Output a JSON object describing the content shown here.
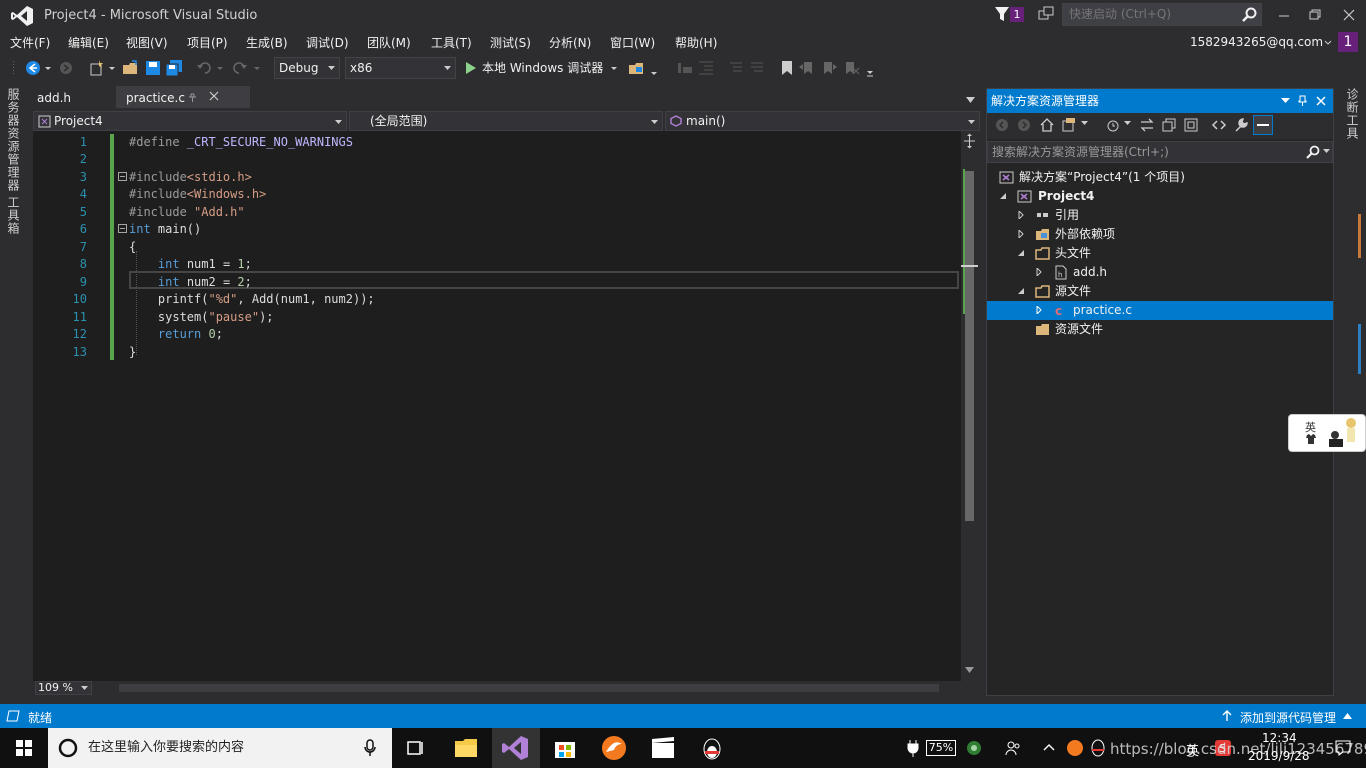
{
  "window": {
    "title": "Project4 - Microsoft Visual Studio",
    "notification_count": "1"
  },
  "quick_launch": {
    "placeholder": "快速启动 (Ctrl+Q)"
  },
  "menu": [
    "文件(F)",
    "编辑(E)",
    "视图(V)",
    "项目(P)",
    "生成(B)",
    "调试(D)",
    "团队(M)",
    "工具(T)",
    "测试(S)",
    "分析(N)",
    "窗口(W)",
    "帮助(H)"
  ],
  "account": {
    "email": "1582943265@qq.com",
    "badge": "1"
  },
  "toolbar": {
    "config": "Debug",
    "platform": "x86",
    "run_label": "本地 Windows 调试器"
  },
  "left_strip": {
    "server_explorer": "服务器资源管理器",
    "toolbox": "工具箱"
  },
  "right_strip": {
    "diagnostics": "诊断工具"
  },
  "tabs": [
    {
      "label": "add.h"
    },
    {
      "label": "practice.c"
    }
  ],
  "navbar": {
    "project": "Project4",
    "scope": "(全局范围)",
    "member": "main()"
  },
  "editor": {
    "zoom": "109 %",
    "line_numbers": [
      "1",
      "2",
      "3",
      "4",
      "5",
      "6",
      "7",
      "8",
      "9",
      "10",
      "11",
      "12",
      "13"
    ]
  },
  "solution_explorer": {
    "title": "解决方案资源管理器",
    "search_placeholder": "搜索解决方案资源管理器(Ctrl+;)",
    "tree": {
      "solution": "解决方案“Project4”(1 个项目)",
      "project": "Project4",
      "references": "引用",
      "external_deps": "外部依赖项",
      "header_files": "头文件",
      "add_h": "add.h",
      "source_files": "源文件",
      "practice_c": "practice.c",
      "resource_files": "资源文件"
    }
  },
  "statusbar": {
    "ready": "就绪",
    "source_control": "添加到源代码管理"
  },
  "taskbar": {
    "search_placeholder": "在这里输入你要搜索的内容",
    "battery": "75%",
    "ime": "英",
    "time": "12:34",
    "date": "2019/9/28",
    "watermark": "https://blog.csdn.net/lili1234567898"
  },
  "ime_widget": {
    "label": "英"
  },
  "colors": {
    "accent": "#007acc",
    "badge": "#68217a",
    "editor_bg": "#1e1e1e",
    "line_number": "#2b91af",
    "keyword": "#569cd6",
    "string": "#d69d85",
    "changed": "#57a64a"
  }
}
